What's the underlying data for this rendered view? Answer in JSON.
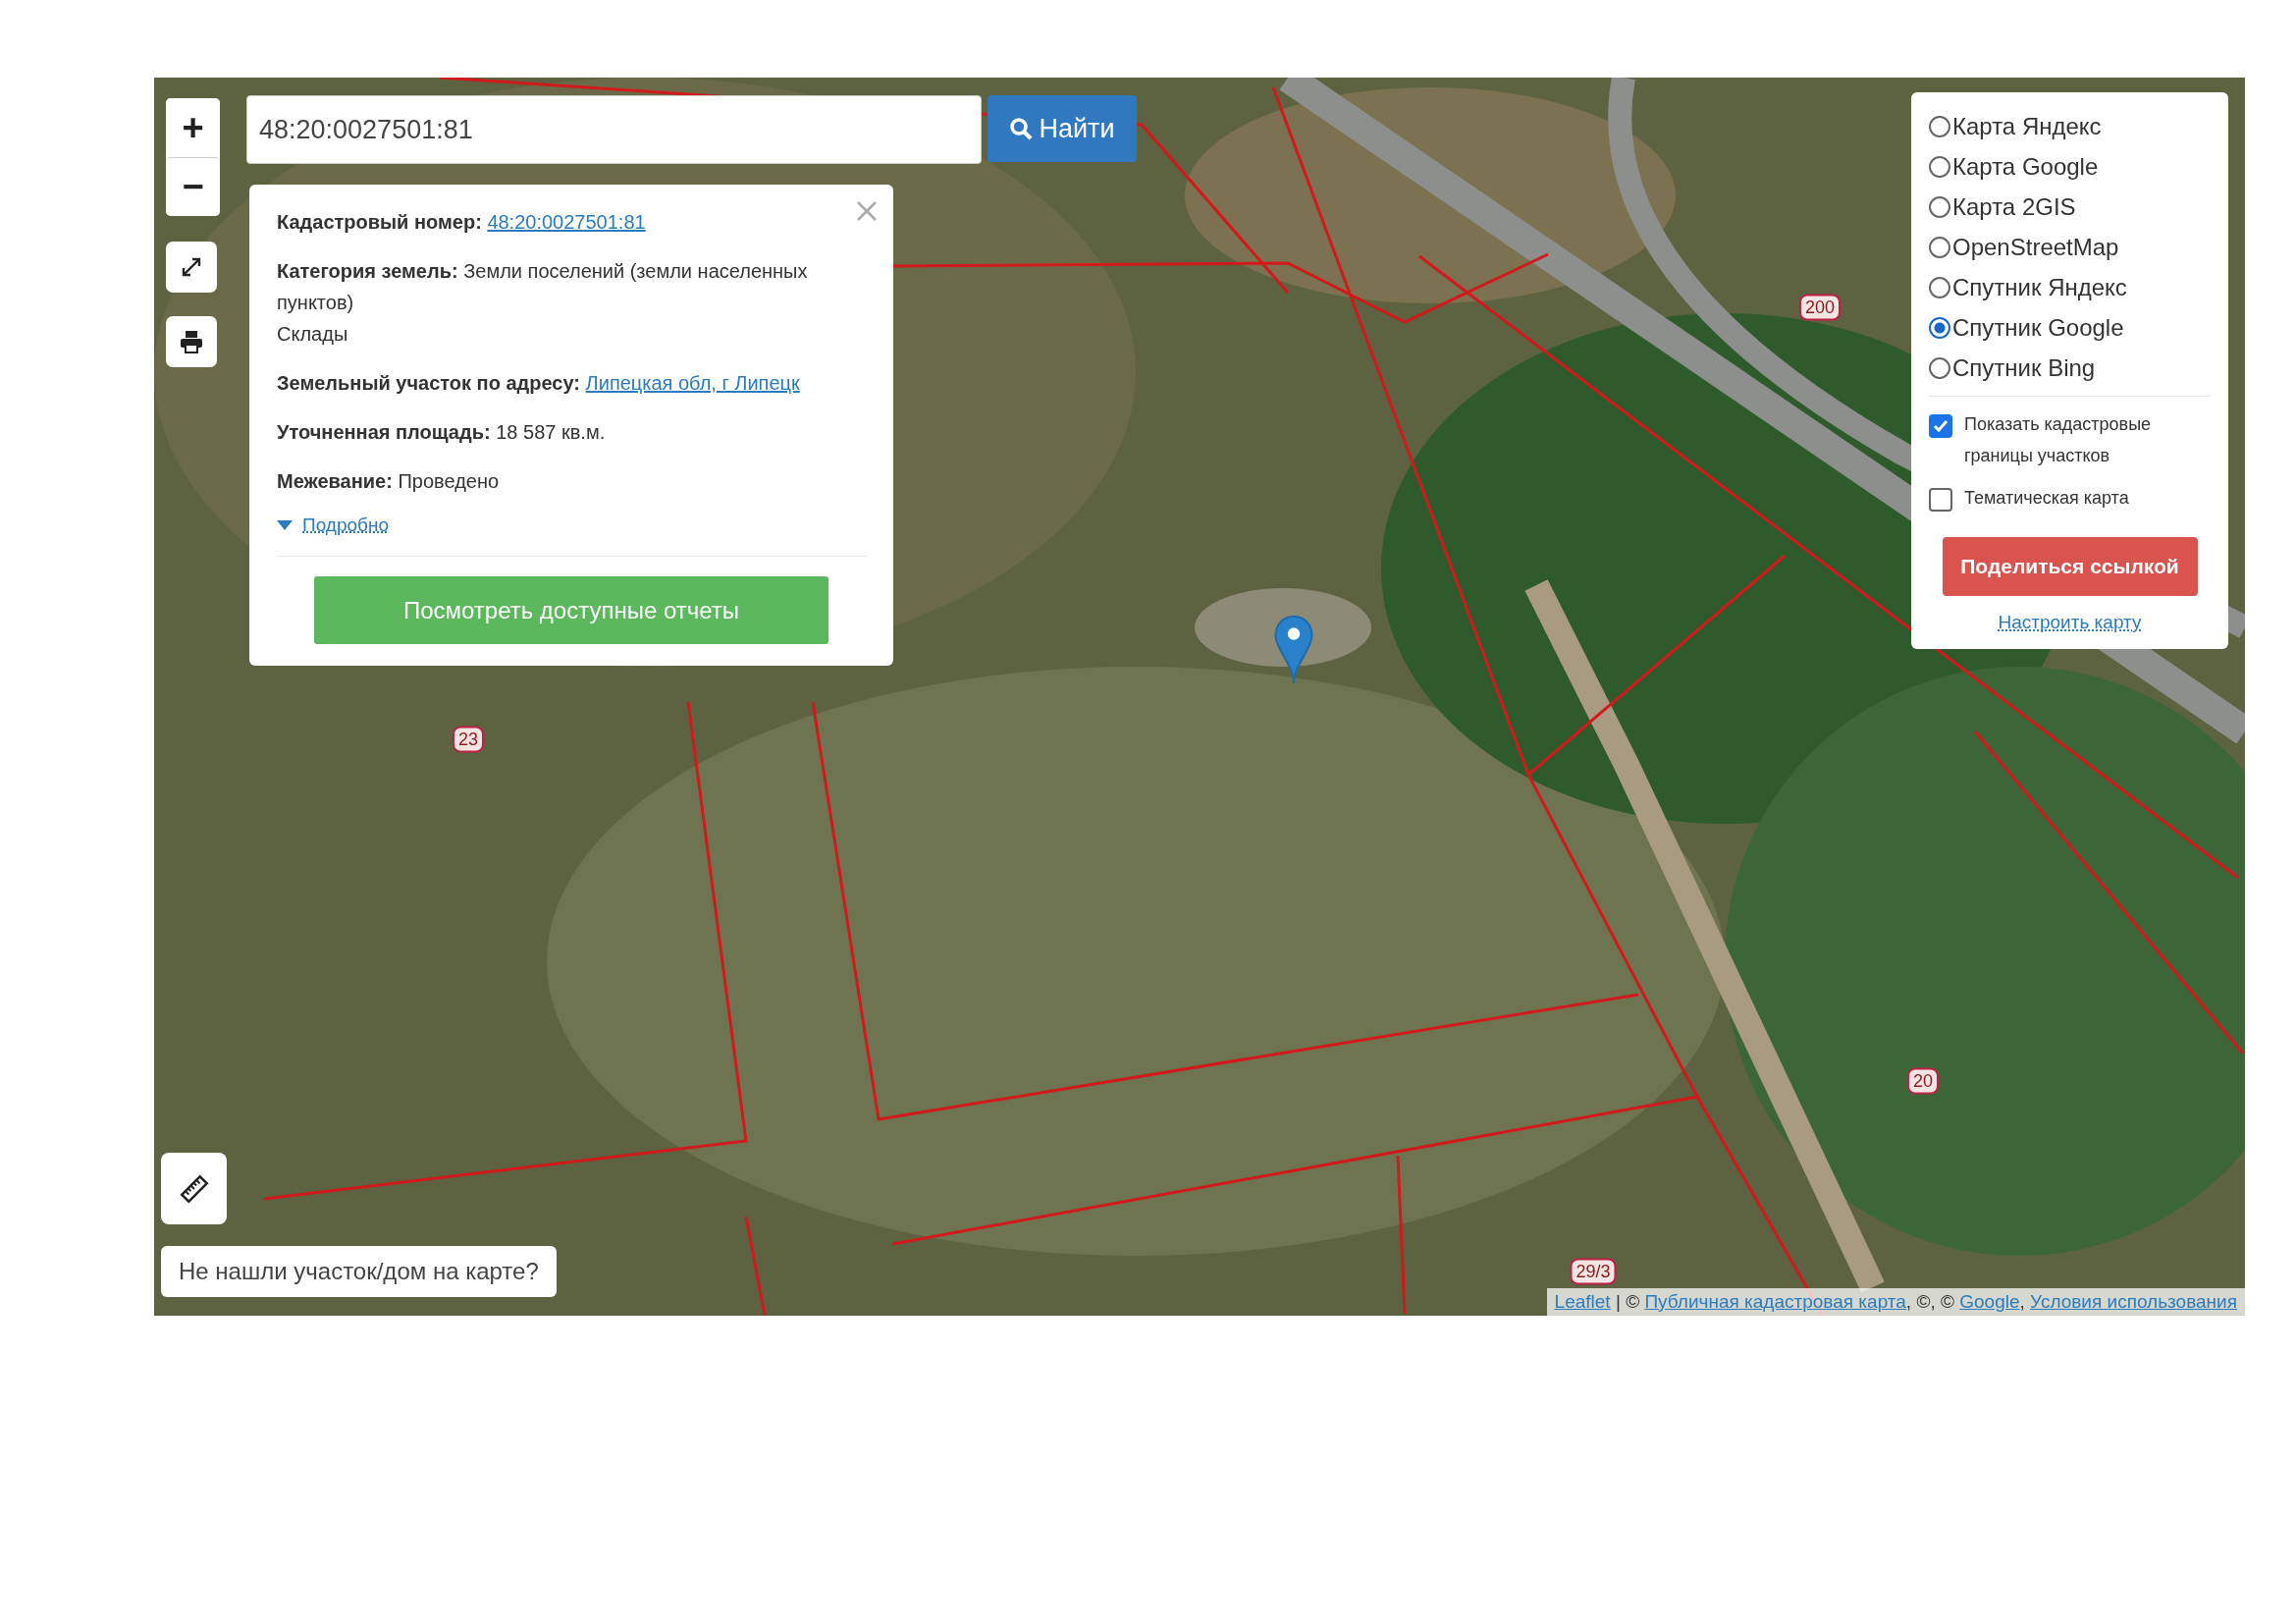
{
  "zoom": {
    "in": "+",
    "out": "−"
  },
  "search": {
    "value": "48:20:0027501:81",
    "button": "Найти"
  },
  "popup": {
    "fields": [
      {
        "kind": "link",
        "label": "Кадастровый номер:",
        "value": "48:20:0027501:81"
      },
      {
        "kind": "text",
        "label": "Категория земель:",
        "value": "Земли поселений (земли населенных пунктов)",
        "note": "Склады"
      },
      {
        "kind": "link",
        "label": "Земельный участок по адресу:",
        "value": "Липецкая обл, г Липецк"
      },
      {
        "kind": "text",
        "label": "Уточненная площадь:",
        "value": "18 587 кв.м."
      },
      {
        "kind": "text",
        "label": "Межевание:",
        "value": "Проведено"
      }
    ],
    "details_link": "Подробно",
    "report_button": "Посмотреть доступные отчеты"
  },
  "layers": [
    {
      "label": "Карта Яндекс",
      "selected": false
    },
    {
      "label": "Карта Google",
      "selected": false
    },
    {
      "label": "Карта 2GIS",
      "selected": false
    },
    {
      "label": "OpenStreetMap",
      "selected": false
    },
    {
      "label": "Спутник Яндекс",
      "selected": false
    },
    {
      "label": "Спутник Google",
      "selected": true
    },
    {
      "label": "Спутник Bing",
      "selected": false
    }
  ],
  "overlays": [
    {
      "label": "Показать кадастровые границы участков",
      "checked": true
    },
    {
      "label": "Тематическая карта",
      "checked": false
    }
  ],
  "share_button": "Поделиться ссылкой",
  "settings_link": "Настроить карту",
  "map_labels": [
    "200",
    "23",
    "20",
    "29/3"
  ],
  "not_found_button": "Не нашли участок/дом на карте?",
  "attribution": [
    {
      "kind": "link",
      "text": "Leaflet"
    },
    {
      "kind": "text",
      "text": " | © "
    },
    {
      "kind": "link",
      "text": "Публичная кадастровая карта"
    },
    {
      "kind": "text",
      "text": ", ©, © "
    },
    {
      "kind": "link",
      "text": "Google"
    },
    {
      "kind": "text",
      "text": ", "
    },
    {
      "kind": "link",
      "text": "Условия использования"
    }
  ]
}
